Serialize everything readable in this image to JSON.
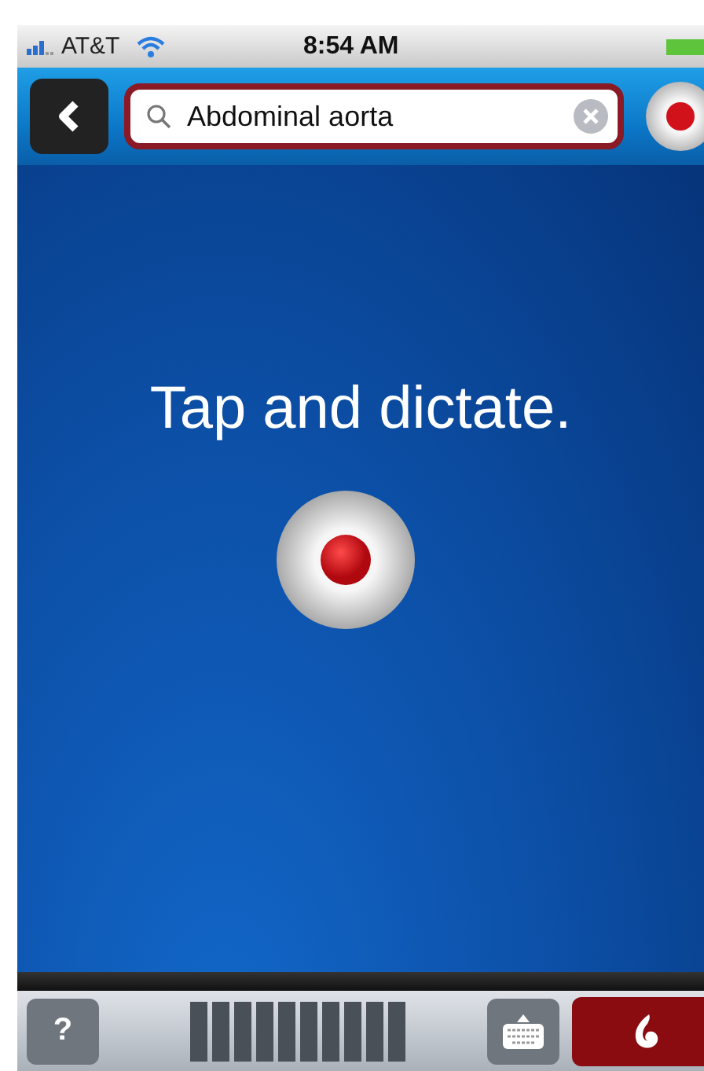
{
  "status_bar": {
    "carrier": "AT&T",
    "time": "8:54 AM"
  },
  "search": {
    "value": "Abdominal aorta"
  },
  "prompt": "Tap and dictate.",
  "bottom_bar": {
    "help_label": "?"
  }
}
